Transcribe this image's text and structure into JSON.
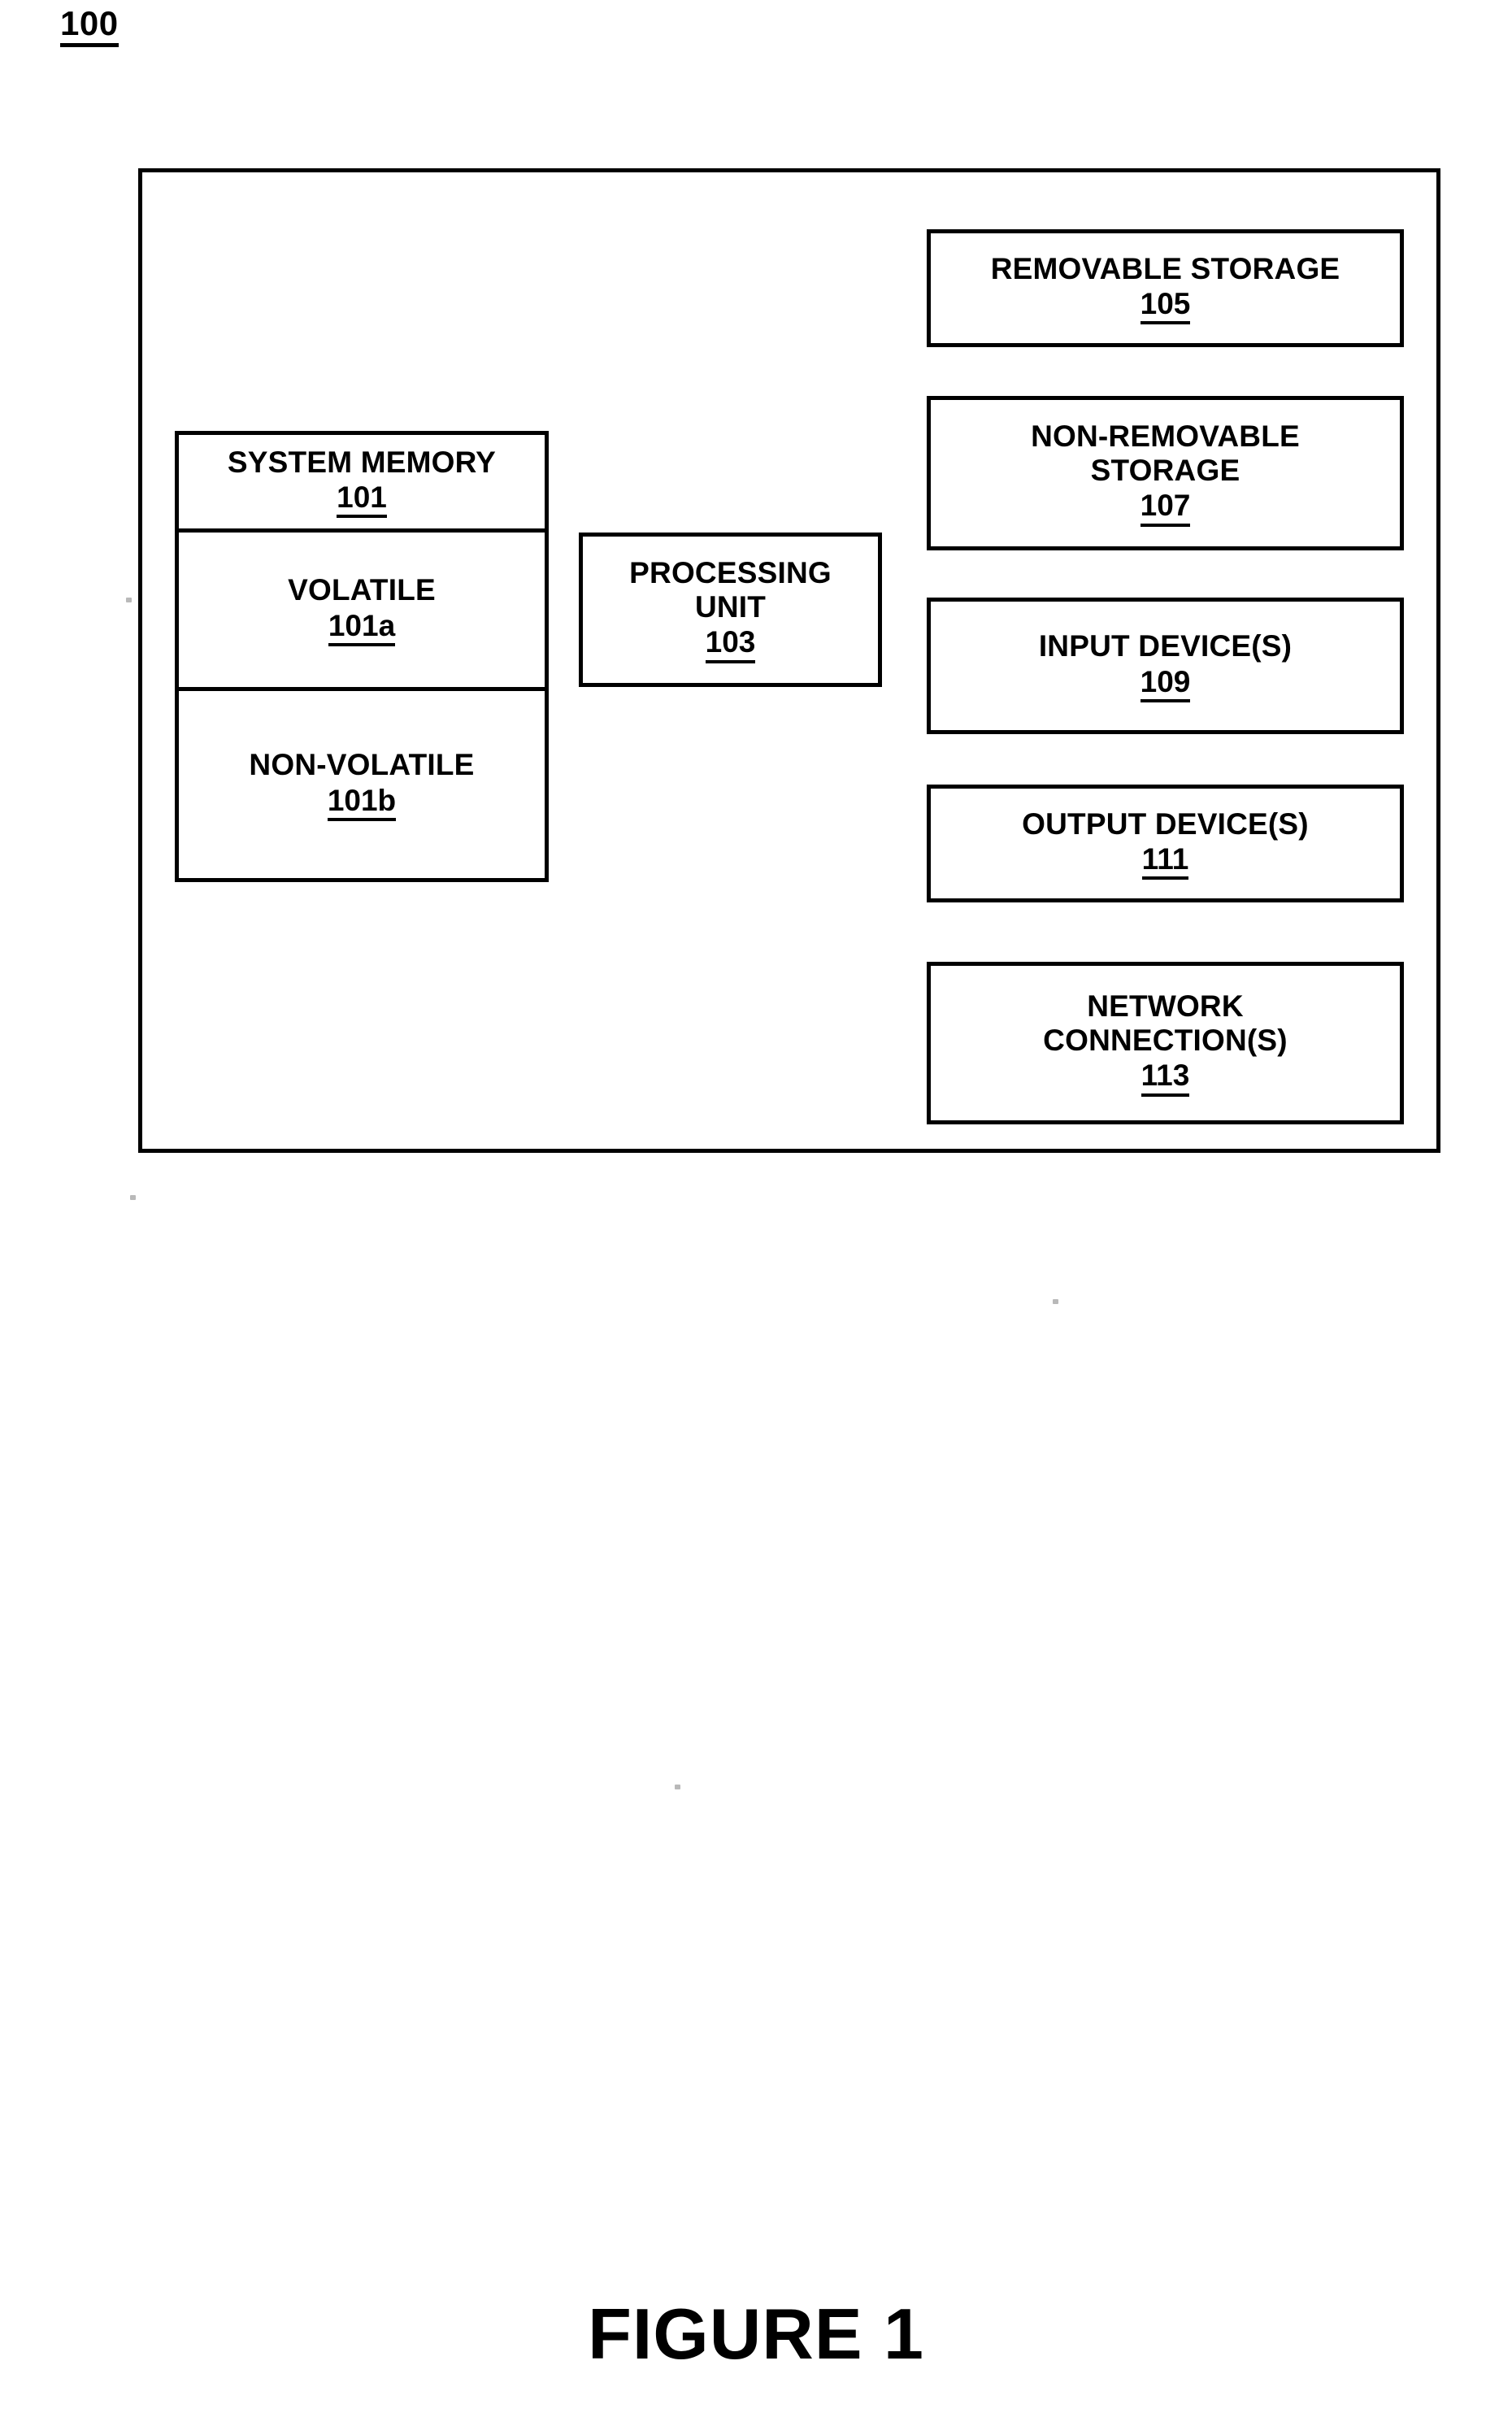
{
  "figure": {
    "reference_label": "100",
    "caption": "FIGURE 1"
  },
  "diagram": {
    "system_memory": {
      "title": "SYSTEM MEMORY",
      "number": "101",
      "volatile": {
        "title": "VOLATILE",
        "number": "101a"
      },
      "non_volatile": {
        "title": "NON-VOLATILE",
        "number": "101b"
      }
    },
    "processing_unit": {
      "title": "PROCESSING\nUNIT",
      "number": "103"
    },
    "removable_storage": {
      "title": "REMOVABLE STORAGE",
      "number": "105"
    },
    "non_removable_storage": {
      "title": "NON-REMOVABLE\nSTORAGE",
      "number": "107"
    },
    "input_devices": {
      "title": "INPUT DEVICE(S)",
      "number": "109"
    },
    "output_devices": {
      "title": "OUTPUT DEVICE(S)",
      "number": "111"
    },
    "network_connections": {
      "title": "NETWORK\nCONNECTION(S)",
      "number": "113"
    }
  }
}
